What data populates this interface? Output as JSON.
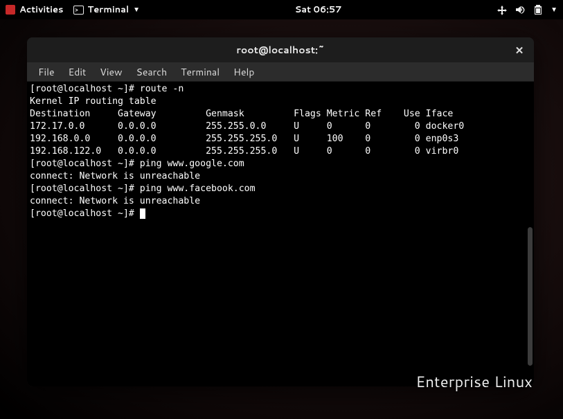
{
  "topbar": {
    "activities": "Activities",
    "app_name": "Terminal",
    "clock": "Sat 06:57"
  },
  "window": {
    "title": "root@localhost:~"
  },
  "menubar": {
    "file": "File",
    "edit": "Edit",
    "view": "View",
    "search": "Search",
    "terminal": "Terminal",
    "help": "Help"
  },
  "terminal": {
    "lines": [
      "[root@localhost ~]# route -n",
      "Kernel IP routing table",
      "Destination     Gateway         Genmask         Flags Metric Ref    Use Iface",
      "172.17.0.0      0.0.0.0         255.255.0.0     U     0      0        0 docker0",
      "192.168.0.0     0.0.0.0         255.255.255.0   U     100    0        0 enp0s3",
      "192.168.122.0   0.0.0.0         255.255.255.0   U     0      0        0 virbr0",
      "[root@localhost ~]# ping www.google.com",
      "connect: Network is unreachable",
      "[root@localhost ~]# ping www.facebook.com",
      "connect: Network is unreachable",
      "[root@localhost ~]# "
    ]
  },
  "brand": "Enterprise Linux"
}
